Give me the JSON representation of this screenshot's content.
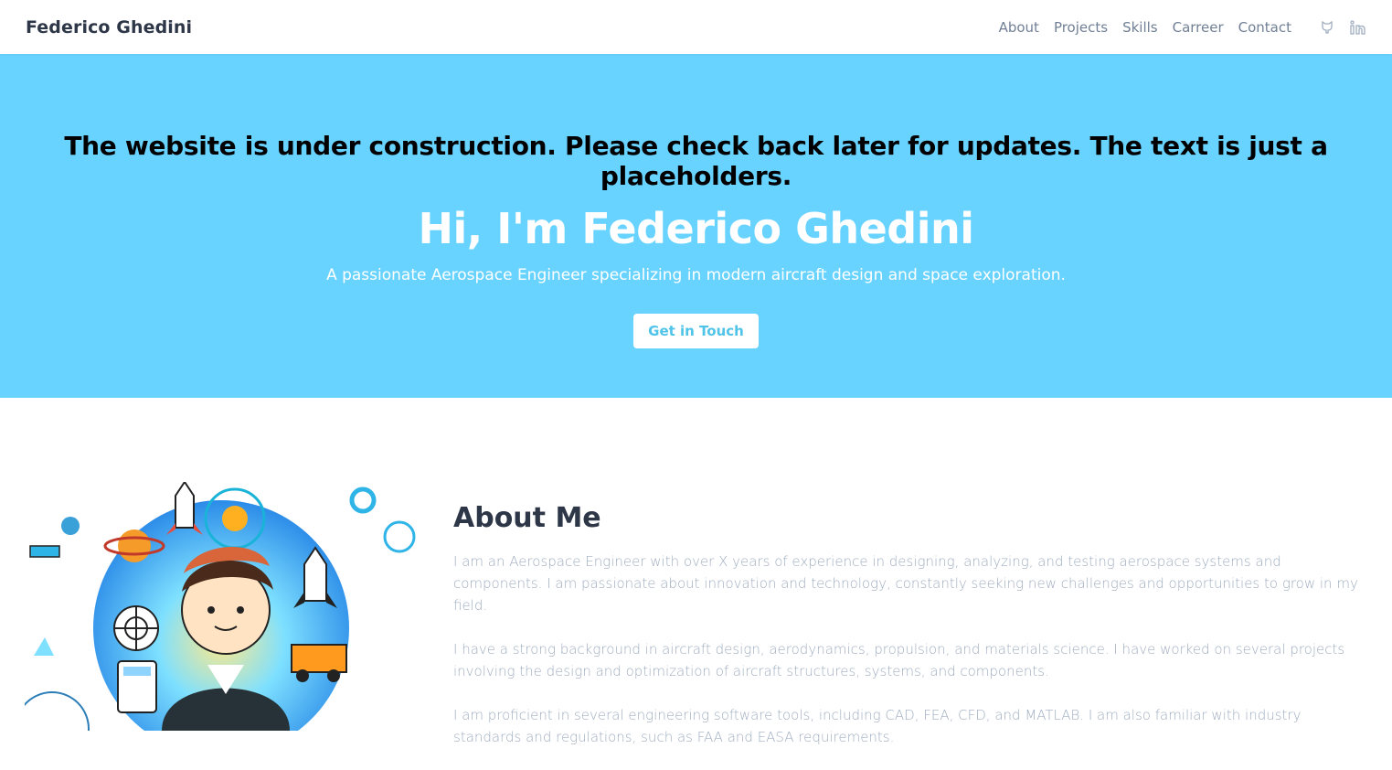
{
  "header": {
    "brand": "Federico Ghedini",
    "nav": [
      "About",
      "Projects",
      "Skills",
      "Carreer",
      "Contact"
    ],
    "social_icons": [
      "github-icon",
      "linkedin-icon"
    ]
  },
  "hero": {
    "notice": "The website is under construction. Please check back later for updates. The text is just a placeholders.",
    "title": "Hi, I'm Federico Ghedini",
    "subtitle": "A passionate Aerospace Engineer specializing in modern aircraft design and space exploration.",
    "cta_label": "Get in Touch"
  },
  "about": {
    "title": "About Me",
    "paragraphs": [
      "I am an Aerospace Engineer with over X years of experience in designing, analyzing, and testing aerospace systems and components. I am passionate about innovation and technology, constantly seeking new challenges and opportunities to grow in my field.",
      "I have a strong background in aircraft design, aerodynamics, propulsion, and materials science. I have worked on several projects involving the design and optimization of aircraft structures, systems, and components.",
      "I am proficient in several engineering software tools, including CAD, FEA, CFD, and MATLAB. I am also familiar with industry standards and regulations, such as FAA and EASA requirements."
    ]
  },
  "colors": {
    "hero_bg": "#69d3ff",
    "cta_text": "#4fc3e8",
    "heading": "#2d3748",
    "body_text": "#a0aec0"
  }
}
